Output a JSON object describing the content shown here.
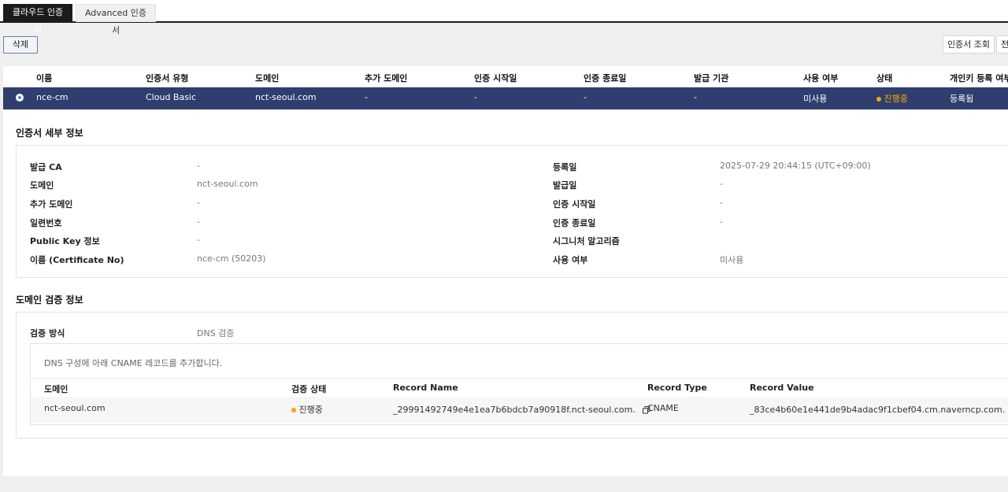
{
  "tabs": [
    {
      "label": "클라우드 인증서",
      "active": true
    },
    {
      "label": "Advanced 인증서",
      "active": false
    }
  ],
  "toolbar": {
    "delete_label": "삭제",
    "lookup_label": "인증서 조회",
    "cut_label": "전"
  },
  "table": {
    "columns": [
      "이름",
      "인증서 유형",
      "도메인",
      "추가 도메인",
      "인증 시작일",
      "인증 종료일",
      "발급 기관",
      "사용 여부",
      "상태",
      "개인키 등록 여부"
    ],
    "rows": [
      {
        "name": "nce-cm",
        "type": "Cloud Basic",
        "domain": "nct-seoul.com",
        "extra_domain": "-",
        "start": "-",
        "end": "-",
        "issuer": "-",
        "usage": "미사용",
        "status": "진행중",
        "private_key": "등록됨"
      }
    ]
  },
  "details": {
    "title": "인증서 세부 정보",
    "left": [
      {
        "label": "발급 CA",
        "value": "-"
      },
      {
        "label": "도메인",
        "value": "nct-seoul.com"
      },
      {
        "label": "추가 도메인",
        "value": "-"
      },
      {
        "label": "일련번호",
        "value": "-"
      },
      {
        "label": "Public Key 정보",
        "value": "-"
      },
      {
        "label": "이름 (Certificate No)",
        "value": "nce-cm (50203)"
      }
    ],
    "right": [
      {
        "label": "등록일",
        "value": "2025-07-29 20:44:15 (UTC+09:00)"
      },
      {
        "label": "발급일",
        "value": "-"
      },
      {
        "label": "인증 시작일",
        "value": "-"
      },
      {
        "label": "인증 종료일",
        "value": "-"
      },
      {
        "label": "시그니처 알고리즘",
        "value": ""
      },
      {
        "label": "사용 여부",
        "value": "미사용"
      }
    ]
  },
  "domain_validation": {
    "title": "도메인 검증 정보",
    "method_label": "검증 방식",
    "method_value": "DNS 검증",
    "instruction": "DNS 구성에 아래 CNAME 레코드를 추가합니다.",
    "columns": [
      "도메인",
      "검증 상태",
      "Record Name",
      "Record Type",
      "Record Value"
    ],
    "rows": [
      {
        "domain": "nct-seoul.com",
        "status": "진행중",
        "record_name": "_29991492749e4e1ea7b6bdcb7a90918f.nct-seoul.com.",
        "record_type": "CNAME",
        "record_value": "_83ce4b60e1e441de9b4adac9f1cbef04.cm.naverncp.com."
      }
    ]
  },
  "colors": {
    "selected_row": "#2f3e6e",
    "status_dot": "#f5a700",
    "radio": "#2f91ff"
  },
  "icons": {
    "copy": "copy-icon"
  }
}
